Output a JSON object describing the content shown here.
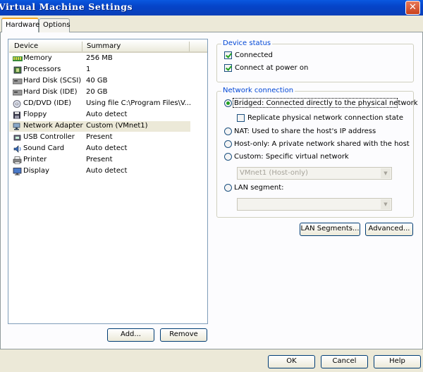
{
  "window": {
    "title": "Virtual Machine Settings",
    "close_glyph": "✕"
  },
  "tabs": [
    {
      "label": "Hardware"
    },
    {
      "label": "Options"
    }
  ],
  "device_list": {
    "columns": {
      "device": "Device",
      "summary": "Summary"
    },
    "selected_index": 8,
    "rows": [
      {
        "device": "Memory",
        "summary": "256 MB",
        "icon": "memory-icon"
      },
      {
        "device": "Processors",
        "summary": "1",
        "icon": "processor-icon"
      },
      {
        "device": "Hard Disk (SCSI)",
        "summary": "40 GB",
        "icon": "hard-disk-icon"
      },
      {
        "device": "Hard Disk (IDE)",
        "summary": "20 GB",
        "icon": "hard-disk-icon"
      },
      {
        "device": "CD/DVD (IDE)",
        "summary": "Using file C:\\Program Files\\V...",
        "icon": "cd-dvd-icon"
      },
      {
        "device": "Floppy",
        "summary": "Auto detect",
        "icon": "floppy-icon"
      },
      {
        "device": "Network Adapter",
        "summary": "Custom (VMnet1)",
        "icon": "network-adapter-icon"
      },
      {
        "device": "USB Controller",
        "summary": "Present",
        "icon": "usb-icon"
      },
      {
        "device": "Sound Card",
        "summary": "Auto detect",
        "icon": "sound-card-icon"
      },
      {
        "device": "Printer",
        "summary": "Present",
        "icon": "printer-icon"
      },
      {
        "device": "Display",
        "summary": "Auto detect",
        "icon": "display-icon"
      }
    ]
  },
  "list_buttons": {
    "add": "Add...",
    "remove": "Remove"
  },
  "device_status": {
    "title": "Device status",
    "connected": {
      "label": "Connected",
      "checked": true
    },
    "connect_at_power_on": {
      "label": "Connect at power on",
      "checked": true
    }
  },
  "network_connection": {
    "title": "Network connection",
    "bridged": {
      "label": "Bridged: Connected directly to the physical network",
      "selected": true
    },
    "replicate": {
      "label": "Replicate physical network connection state",
      "checked": false
    },
    "nat": {
      "label": "NAT: Used to share the host's IP address",
      "selected": false
    },
    "host_only": {
      "label": "Host-only: A private network shared with the host",
      "selected": false
    },
    "custom": {
      "label": "Custom: Specific virtual network",
      "selected": false
    },
    "custom_select": {
      "value": "VMnet1 (Host-only)"
    },
    "lan_segment": {
      "label": "LAN segment:",
      "selected": false
    },
    "lan_select": {
      "value": ""
    },
    "lan_segments_button": "LAN Segments...",
    "advanced_button": "Advanced..."
  },
  "dialog_buttons": {
    "ok": "OK",
    "cancel": "Cancel",
    "help": "Help"
  }
}
